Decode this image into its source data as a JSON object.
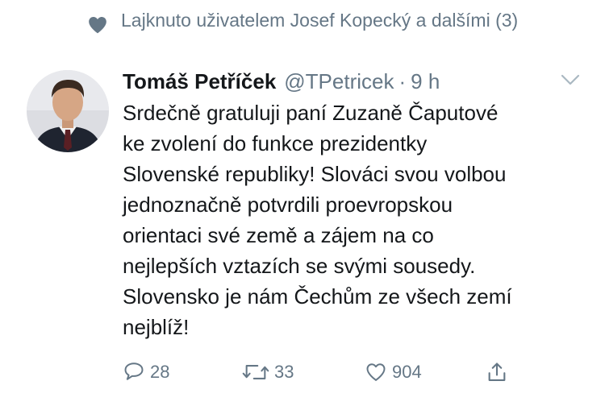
{
  "social_context": {
    "icon": "heart-icon",
    "text": "Lajknuto uživatelem Josef Kopecký a dalšími (3)"
  },
  "tweet": {
    "author_name": "Tomáš Petříček",
    "handle": "@TPetricek",
    "separator": "·",
    "time": "9 h",
    "text": "Srdečně gratuluji paní Zuzaně Čaputové\nke zvolení do funkce prezidentky\nSlovenské republiky! Slováci svou volbou\njednoznačně potvrdili proevropskou\norientaci své země a zájem na co\nnejlepších vztazích se svými sousedy.\nSlovensko je nám Čechům ze všech zemí\nnejblíž!",
    "actions": {
      "replies": "28",
      "retweets": "33",
      "likes": "904"
    }
  },
  "colors": {
    "secondary_text": "#657786",
    "primary_text": "#14171a",
    "icon": "#657786"
  }
}
